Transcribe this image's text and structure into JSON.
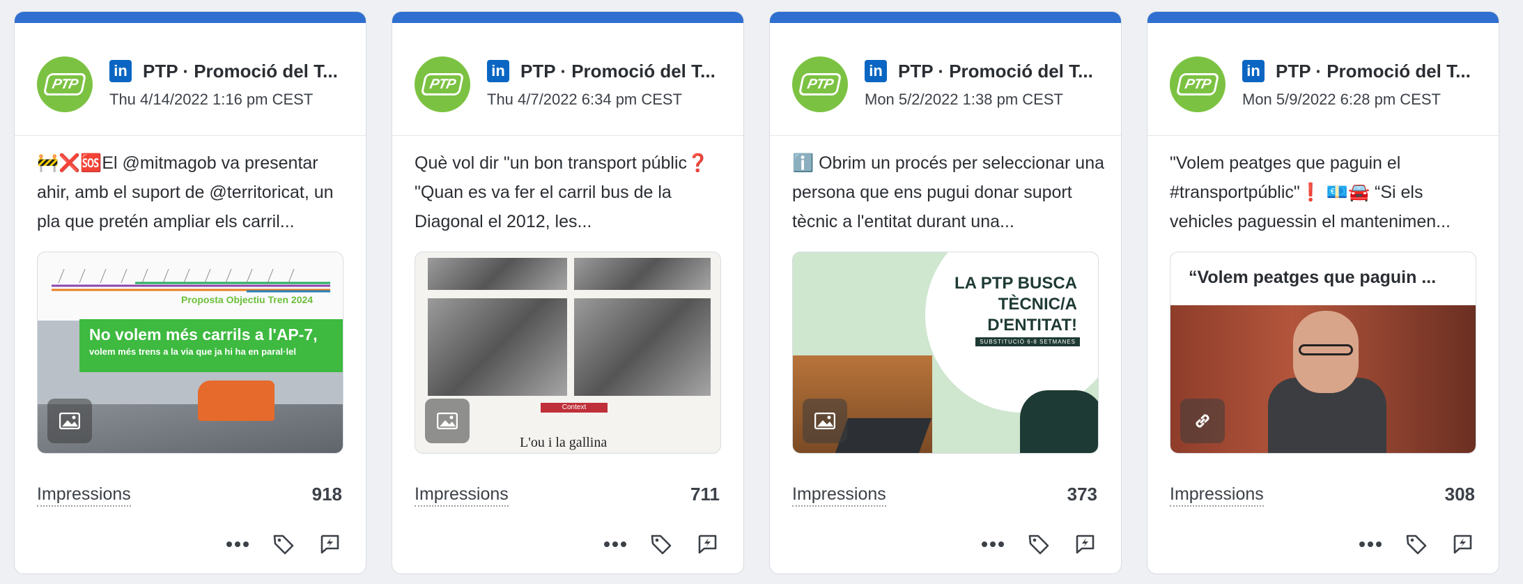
{
  "metric_label": "Impressions",
  "icons": {
    "network": "linkedin-icon",
    "media_image": "image-icon",
    "media_link": "link-icon",
    "more": "more-horizontal-icon",
    "tag": "tag-icon",
    "boost": "boost-lightning-icon"
  },
  "colors": {
    "accent_bar": "#2f6fcf",
    "avatar_green": "#7cc242",
    "linkedin_blue": "#0a66c2"
  },
  "cards": [
    {
      "avatar_text": "PTP",
      "account": "PTP · Promoció del T...",
      "date": "Thu 4/14/2022 1:16 pm CEST",
      "text": "🚧❌🆘El @mitmagob va presentar ahir, amb el suport de @territoricat, un pla que pretén ampliar els carril...",
      "media": {
        "type": "image",
        "proposal": "Proposta Objectiu Tren 2024",
        "banner_title": "No volem més carrils a l'AP-7,",
        "banner_subtitle": "volem més trens a la via que ja hi ha en paral·lel"
      },
      "impressions": "918"
    },
    {
      "avatar_text": "PTP",
      "account": "PTP · Promoció del T...",
      "date": "Thu 4/7/2022 6:34 pm CEST",
      "text": "Què vol dir \"un bon transport públic❓ \"Quan es va fer el carril bus de la Diagonal el 2012, les...",
      "media": {
        "type": "image",
        "context_tag": "Context",
        "headline": "L'ou i la gallina"
      },
      "impressions": "711"
    },
    {
      "avatar_text": "PTP",
      "account": "PTP · Promoció del T...",
      "date": "Mon 5/2/2022 1:38 pm CEST",
      "text": "ℹ️ Obrim un procés per seleccionar una persona que ens pugui donar suport tècnic a l'entitat durant una...",
      "media": {
        "type": "image",
        "title_lines": [
          "LA PTP BUSCA",
          "TÈCNIC/A",
          "D'ENTITAT!"
        ],
        "subtitle": "SUBSTITUCIÓ 6-8 SETMANES"
      },
      "impressions": "373"
    },
    {
      "avatar_text": "PTP",
      "account": "PTP · Promoció del T...",
      "date": "Mon 5/9/2022 6:28 pm CEST",
      "text": "\"Volem peatges que paguin el #transportpúblic\"❗ 💶🚘 “Si els vehicles paguessin el mantenimen...",
      "media": {
        "type": "link",
        "link_title": "“Volem peatges que paguin ..."
      },
      "impressions": "308"
    }
  ]
}
